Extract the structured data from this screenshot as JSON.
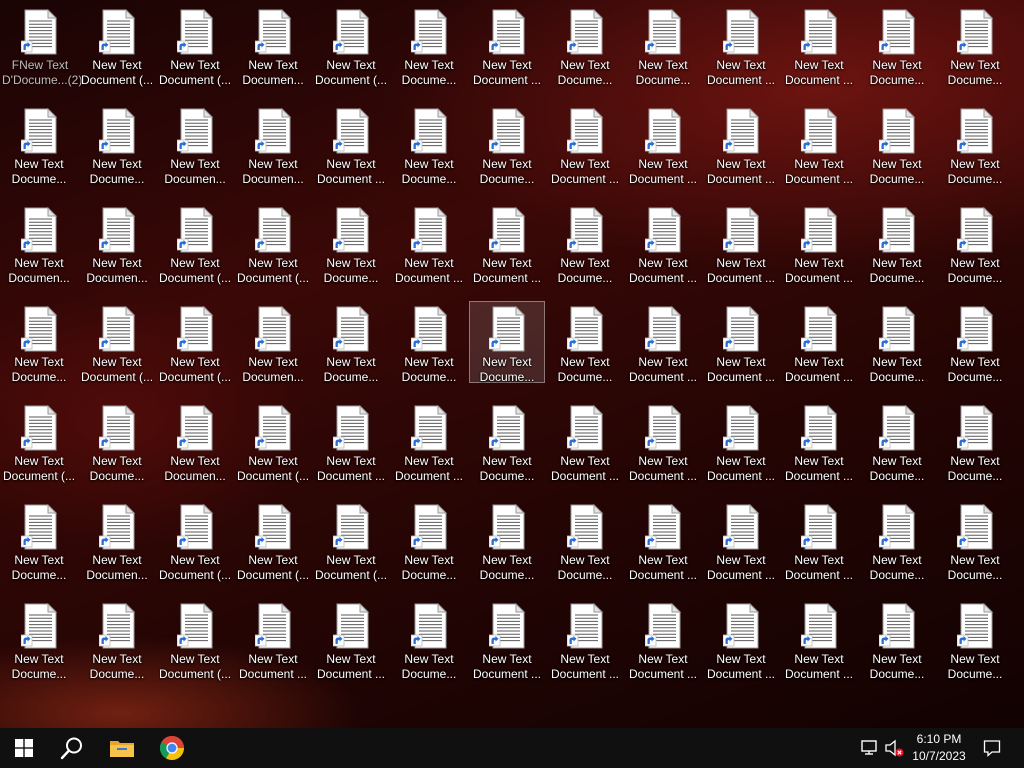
{
  "desktop": {
    "columns": 13,
    "rows": 7,
    "selected_index": 45,
    "labels": [
      [
        "New Text",
        "Docume...(2)"
      ],
      [
        "New Text",
        "Document (..."
      ],
      [
        "New Text",
        "Document (..."
      ],
      [
        "New Text",
        "Documen..."
      ],
      [
        "New Text",
        "Document (..."
      ],
      [
        "New Text",
        "Docume..."
      ],
      [
        "New Text",
        "Document ..."
      ],
      [
        "New Text",
        "Docume..."
      ],
      [
        "New Text",
        "Docume..."
      ],
      [
        "New Text",
        "Document ..."
      ],
      [
        "New Text",
        "Document ..."
      ],
      [
        "New Text",
        "Docume..."
      ],
      [
        "New Text",
        "Docume..."
      ],
      [
        "New Text",
        "Docume..."
      ],
      [
        "New Text",
        "Docume..."
      ],
      [
        "New Text",
        "Documen..."
      ],
      [
        "New Text",
        "Documen..."
      ],
      [
        "New Text",
        "Document ..."
      ],
      [
        "New Text",
        "Docume..."
      ],
      [
        "New Text",
        "Docume..."
      ],
      [
        "New Text",
        "Document ..."
      ],
      [
        "New Text",
        "Document ..."
      ],
      [
        "New Text",
        "Document ..."
      ],
      [
        "New Text",
        "Document ..."
      ],
      [
        "New Text",
        "Docume..."
      ],
      [
        "New Text",
        "Docume..."
      ],
      [
        "New Text",
        "Documen..."
      ],
      [
        "New Text",
        "Documen..."
      ],
      [
        "New Text",
        "Document (..."
      ],
      [
        "New Text",
        "Document (..."
      ],
      [
        "New Text",
        "Docume..."
      ],
      [
        "New Text",
        "Document ..."
      ],
      [
        "New Text",
        "Document ..."
      ],
      [
        "New Text",
        "Docume..."
      ],
      [
        "New Text",
        "Document ..."
      ],
      [
        "New Text",
        "Document ..."
      ],
      [
        "New Text",
        "Document ..."
      ],
      [
        "New Text",
        "Docume..."
      ],
      [
        "New Text",
        "Docume..."
      ],
      [
        "New Text",
        "Docume..."
      ],
      [
        "New Text",
        "Document (..."
      ],
      [
        "New Text",
        "Document (..."
      ],
      [
        "New Text",
        "Documen..."
      ],
      [
        "New Text",
        "Docume..."
      ],
      [
        "New Text",
        "Docume..."
      ],
      [
        "New Text",
        "Docume..."
      ],
      [
        "New Text",
        "Docume..."
      ],
      [
        "New Text",
        "Document ..."
      ],
      [
        "New Text",
        "Document ..."
      ],
      [
        "New Text",
        "Document ..."
      ],
      [
        "New Text",
        "Docume..."
      ],
      [
        "New Text",
        "Docume..."
      ],
      [
        "New Text",
        "Document (..."
      ],
      [
        "New Text",
        "Docume..."
      ],
      [
        "New Text",
        "Documen..."
      ],
      [
        "New Text",
        "Document (..."
      ],
      [
        "New Text",
        "Document ..."
      ],
      [
        "New Text",
        "Document ..."
      ],
      [
        "New Text",
        "Docume..."
      ],
      [
        "New Text",
        "Document ..."
      ],
      [
        "New Text",
        "Document ..."
      ],
      [
        "New Text",
        "Document ..."
      ],
      [
        "New Text",
        "Document ..."
      ],
      [
        "New Text",
        "Docume..."
      ],
      [
        "New Text",
        "Docume..."
      ],
      [
        "New Text",
        "Docume..."
      ],
      [
        "New Text",
        "Documen..."
      ],
      [
        "New Text",
        "Document (..."
      ],
      [
        "New Text",
        "Document (..."
      ],
      [
        "New Text",
        "Document (..."
      ],
      [
        "New Text",
        "Docume..."
      ],
      [
        "New Text",
        "Docume..."
      ],
      [
        "New Text",
        "Docume..."
      ],
      [
        "New Text",
        "Document ..."
      ],
      [
        "New Text",
        "Document ..."
      ],
      [
        "New Text",
        "Document ..."
      ],
      [
        "New Text",
        "Docume..."
      ],
      [
        "New Text",
        "Docume..."
      ],
      [
        "New Text",
        "Docume..."
      ],
      [
        "New Text",
        "Docume..."
      ],
      [
        "New Text",
        "Document (..."
      ],
      [
        "New Text",
        "Document ..."
      ],
      [
        "New Text",
        "Document ..."
      ],
      [
        "New Text",
        "Docume..."
      ],
      [
        "New Text",
        "Document ..."
      ],
      [
        "New Text",
        "Document ..."
      ],
      [
        "New Text",
        "Document ..."
      ],
      [
        "New Text",
        "Document ..."
      ],
      [
        "New Text",
        "Document ..."
      ],
      [
        "New Text",
        "Docume..."
      ],
      [
        "New Text",
        "Docume..."
      ]
    ],
    "overlap_label": [
      "FNew Text",
      "D'Docume...(2)"
    ]
  },
  "taskbar": {
    "start_icon": "windows-logo-icon",
    "search_icon": "search-icon",
    "pinned": [
      {
        "name": "file-explorer",
        "icon": "folder-icon"
      },
      {
        "name": "chrome",
        "icon": "chrome-icon"
      }
    ],
    "tray": {
      "network_icon": "network-disconnected-icon",
      "volume_icon": "volume-muted-icon"
    },
    "clock": {
      "time": "6:10 PM",
      "date": "10/7/2023"
    },
    "notification_icon": "notification-icon"
  },
  "colors": {
    "taskbar_bg": "#101010",
    "chrome_red": "#db4437",
    "chrome_yellow": "#f4c20d",
    "chrome_green": "#0f9d58",
    "chrome_blue": "#4285f4",
    "folder_yellow": "#f0b73a",
    "shortcut_arrow": "#2a6fd6",
    "mute_red": "#e81123"
  }
}
